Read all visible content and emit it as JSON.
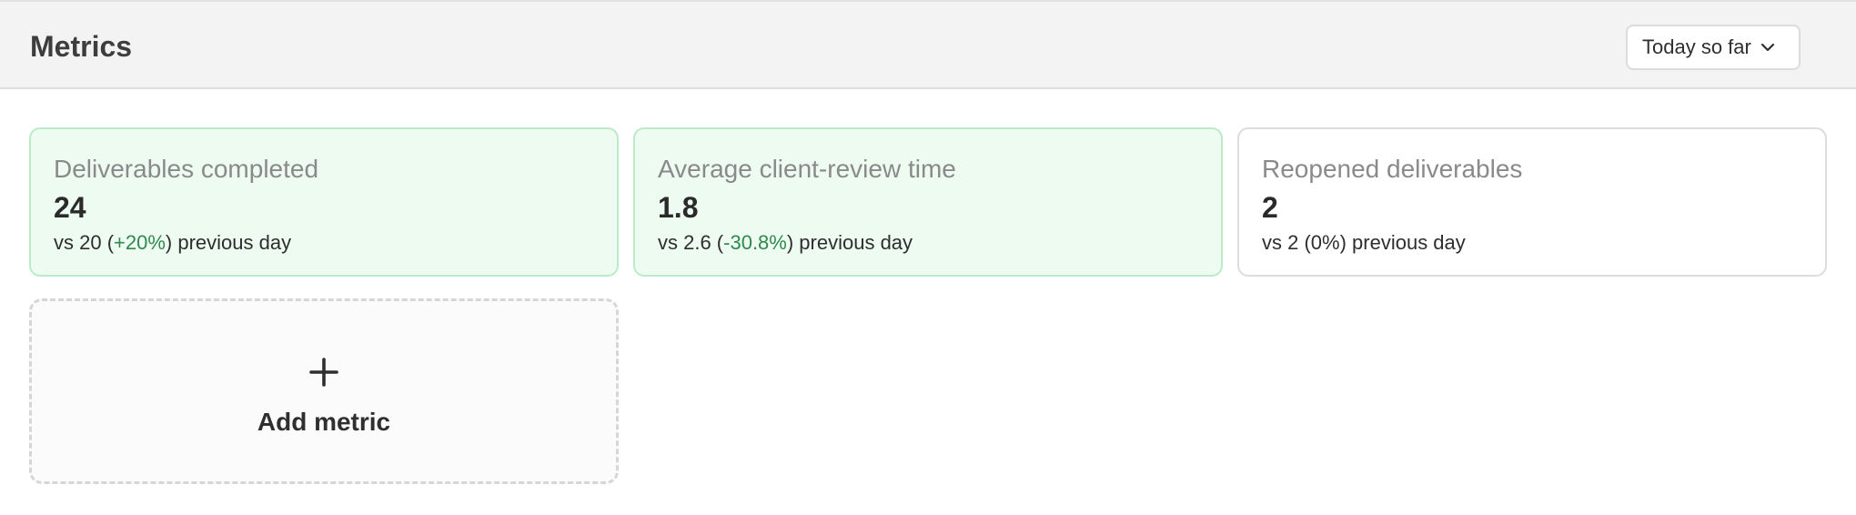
{
  "header": {
    "title": "Metrics",
    "range_select": {
      "selected": "Today so far",
      "icon": "chevron-down-icon"
    }
  },
  "metrics": [
    {
      "label": "Deliverables completed",
      "value": "24",
      "compare_prefix": "vs 20 (",
      "delta": "+20%",
      "compare_suffix": ") previous day",
      "status": "positive"
    },
    {
      "label": "Average client-review time",
      "value": "1.8",
      "compare_prefix": "vs 2.6 (",
      "delta": "-30.8%",
      "compare_suffix": ") previous day",
      "status": "positive"
    },
    {
      "label": "Reopened deliverables",
      "value": "2",
      "compare_prefix": "vs 2 (",
      "delta": "0%",
      "compare_suffix": ") previous day",
      "status": "neutral"
    }
  ],
  "add_metric": {
    "label": "Add metric",
    "icon": "plus-icon"
  },
  "colors": {
    "positive_bg": "#edfbf1",
    "positive_border": "#b9ebc7",
    "positive_text": "#2f8a4f",
    "header_bg": "#f3f3f3"
  }
}
